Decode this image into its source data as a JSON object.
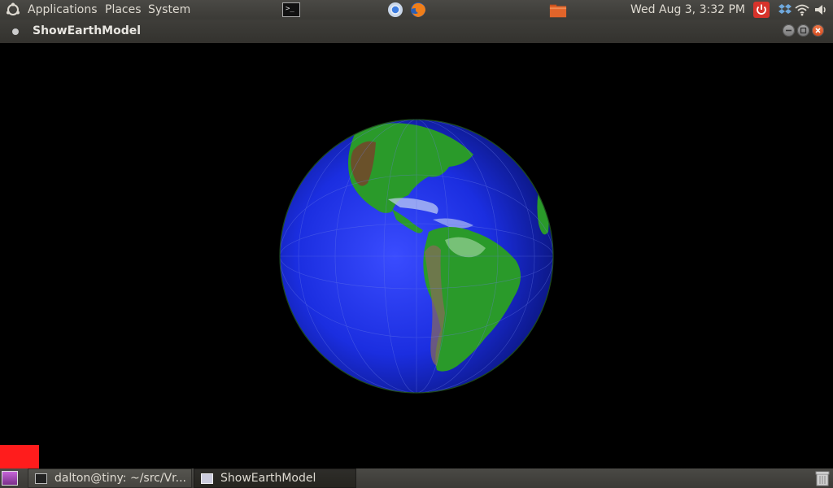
{
  "top_panel": {
    "menus": [
      "Applications",
      "Places",
      "System"
    ],
    "clock": "Wed Aug  3,  3:32 PM",
    "launchers": [
      "terminal-icon",
      "chrome-icon",
      "firefox-icon",
      "folder-icon"
    ],
    "tray": [
      "power-icon",
      "dropbox-icon",
      "wifi-icon"
    ]
  },
  "window": {
    "title": "ShowEarthModel",
    "controls": [
      "minimize",
      "maximize",
      "close"
    ]
  },
  "bottom_panel": {
    "tasks": [
      {
        "label": "dalton@tiny: ~/src/Vr...",
        "icon": "terminal-icon"
      },
      {
        "label": "ShowEarthModel",
        "icon": "window-icon"
      }
    ]
  },
  "colors": {
    "panel": "#3b3a36",
    "close_button": "#d44a1d",
    "ocean": "#1b2ee0",
    "land": "#2a9a2a",
    "red_marker": "#ff1c1c"
  }
}
